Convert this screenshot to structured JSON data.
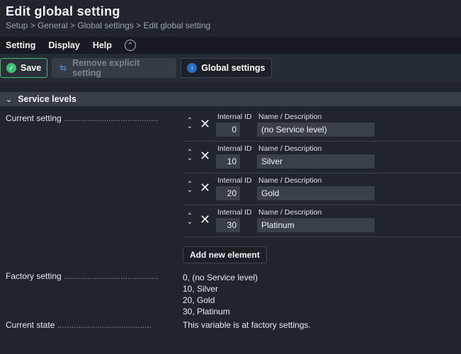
{
  "header": {
    "title": "Edit global setting",
    "breadcrumb": "Setup > General > Global settings > Edit global setting"
  },
  "menu": {
    "items": [
      "Setting",
      "Display",
      "Help"
    ],
    "collapse_icon": "chevron-up-icon"
  },
  "toolbar": {
    "save_label": "Save",
    "remove_label": "Remove explicit setting",
    "global_label": "Global settings",
    "colors": {
      "save_border": "#3fbf73",
      "save_icon": "#3fbf73",
      "global_icon": "#2b6fc2"
    }
  },
  "section": {
    "title": "Service levels",
    "current_setting_label": "Current setting",
    "factory_setting_label": "Factory setting",
    "current_state_label": "Current state",
    "dots": "........................................",
    "entries": [
      {
        "id_header": "Internal ID",
        "name_header": "Name / Description",
        "id": "0",
        "name": "(no Service level)"
      },
      {
        "id_header": "Internal ID",
        "name_header": "Name / Description",
        "id": "10",
        "name": "Silver"
      },
      {
        "id_header": "Internal ID",
        "name_header": "Name / Description",
        "id": "20",
        "name": "Gold"
      },
      {
        "id_header": "Internal ID",
        "name_header": "Name / Description",
        "id": "30",
        "name": "Platinum"
      }
    ],
    "add_label": "Add new element",
    "factory_values": [
      "0, (no Service level)",
      "10, Silver",
      "20, Gold",
      "30, Platinum"
    ],
    "state_text": "This variable is at factory settings."
  }
}
